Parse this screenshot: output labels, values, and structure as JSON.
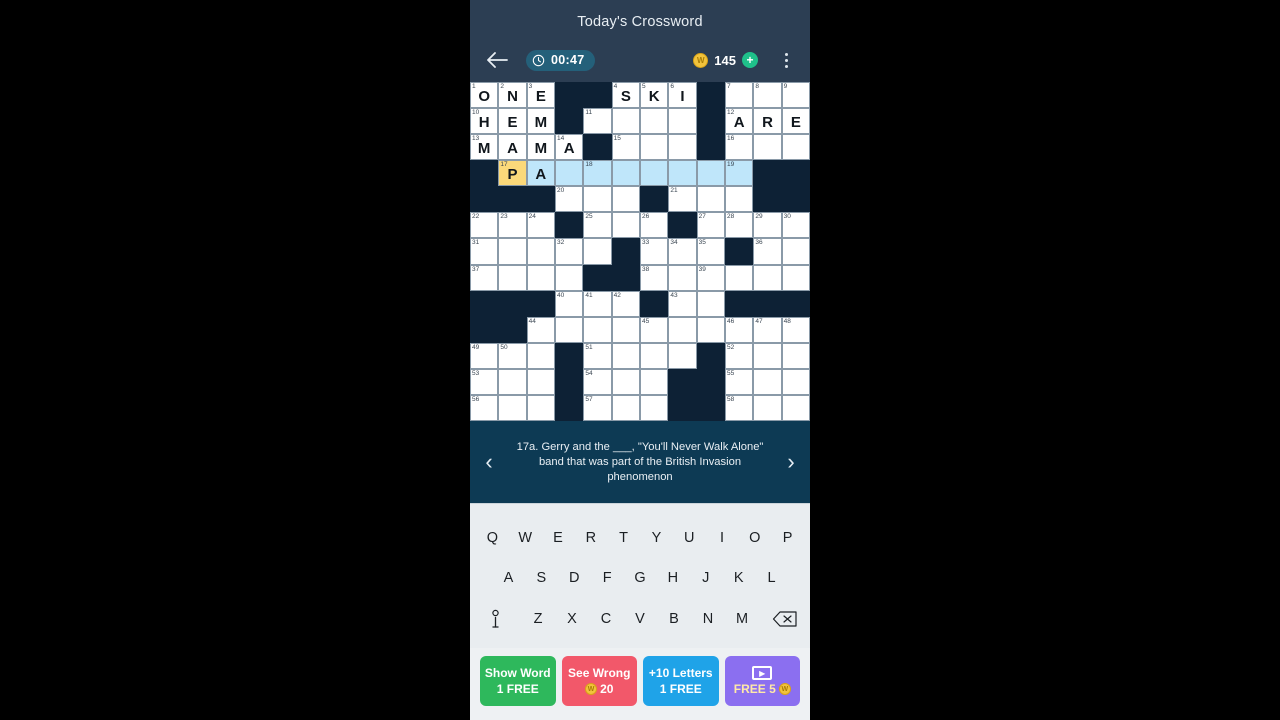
{
  "header": {
    "title": "Today's Crossword",
    "back_icon": "back-arrow-icon",
    "clock_icon": "clock-icon",
    "timer": "00:47",
    "coin_icon": "coin-icon",
    "coin_count": "145",
    "plus_label": "+",
    "menu_icon": "overflow-menu-icon"
  },
  "grid": {
    "rows": 12,
    "cols": 12,
    "colors": {
      "block": "#0d2135",
      "empty": "#ffffff",
      "highlight": "#bfe6fa",
      "cursor": "#fbd97a",
      "border": "#8a9aa8"
    },
    "cells": [
      [
        {
          "n": "1",
          "l": "O"
        },
        {
          "n": "2",
          "l": "N"
        },
        {
          "n": "3",
          "l": "E"
        },
        {
          "b": true
        },
        {
          "b": true
        },
        {
          "n": "4",
          "l": "S"
        },
        {
          "n": "5",
          "l": "K"
        },
        {
          "n": "6",
          "l": "I"
        },
        {
          "b": true
        },
        {
          "n": "7"
        },
        {
          "n": "8"
        },
        {
          "n": "9"
        }
      ],
      [
        {
          "n": "10",
          "l": "H"
        },
        {
          "l": "E"
        },
        {
          "l": "M"
        },
        {
          "b": true
        },
        {
          "n": "11"
        },
        {},
        {},
        {},
        {
          "b": true
        },
        {
          "n": "12",
          "l": "A"
        },
        {
          "l": "R"
        },
        {
          "l": "E"
        }
      ],
      [
        {
          "n": "13",
          "l": "M"
        },
        {
          "l": "A"
        },
        {
          "l": "M"
        },
        {
          "n": "14",
          "l": "A"
        },
        {
          "b": true
        },
        {
          "n": "15"
        },
        {},
        {},
        {
          "b": true
        },
        {
          "n": "16"
        },
        {},
        {}
      ],
      [
        {
          "b": true
        },
        {
          "n": "17",
          "l": "P",
          "c": true
        },
        {
          "l": "A",
          "h": true
        },
        {
          "h": true
        },
        {
          "n": "18",
          "h": true
        },
        {
          "h": true
        },
        {
          "h": true
        },
        {
          "h": true
        },
        {
          "h": true
        },
        {
          "n": "19",
          "h": true
        },
        {
          "b": true
        },
        {
          "b": true
        }
      ],
      [
        {
          "b": true
        },
        {
          "b": true
        },
        {
          "b": true
        },
        {
          "n": "20"
        },
        {},
        {},
        {
          "b": true
        },
        {
          "n": "21"
        },
        {},
        {},
        {
          "b": true
        },
        {
          "b": true
        }
      ],
      [
        {
          "n": "22"
        },
        {
          "n": "23"
        },
        {
          "n": "24"
        },
        {
          "b": true
        },
        {
          "n": "25"
        },
        {},
        {
          "n": "26"
        },
        {
          "b": true
        },
        {
          "n": "27"
        },
        {
          "n": "28"
        },
        {
          "n": "29"
        },
        {
          "n": "30"
        }
      ],
      [
        {
          "n": "31"
        },
        {},
        {},
        {
          "n": "32"
        },
        {},
        {
          "b": true
        },
        {
          "n": "33"
        },
        {
          "n": "34"
        },
        {
          "n": "35"
        },
        {
          "b": true
        },
        {
          "n": "36"
        },
        {}
      ],
      [
        {
          "n": "37"
        },
        {},
        {},
        {},
        {
          "b": true
        },
        {
          "b": true
        },
        {
          "n": "38"
        },
        {},
        {
          "n": "39"
        },
        {},
        {},
        {}
      ],
      [
        {
          "b": true
        },
        {
          "b": true
        },
        {
          "b": true
        },
        {
          "n": "40"
        },
        {
          "n": "41"
        },
        {
          "n": "42"
        },
        {
          "b": true
        },
        {
          "n": "43"
        },
        {},
        {
          "b": true
        },
        {
          "b": true
        },
        {
          "b": true
        }
      ],
      [
        {
          "b": true
        },
        {
          "b": true
        },
        {
          "n": "44"
        },
        {},
        {},
        {},
        {
          "n": "45"
        },
        {},
        {},
        {
          "n": "46"
        },
        {
          "n": "47"
        },
        {
          "n": "48"
        }
      ],
      [
        {
          "n": "49"
        },
        {
          "n": "50"
        },
        {},
        {
          "b": true
        },
        {
          "n": "51"
        },
        {},
        {},
        {},
        {
          "b": true
        },
        {
          "n": "52"
        },
        {},
        {}
      ],
      [
        {
          "n": "53"
        },
        {},
        {},
        {
          "b": true
        },
        {
          "n": "54"
        },
        {},
        {},
        {
          "b": true
        },
        {
          "b": true
        },
        {
          "n": "55"
        },
        {},
        {}
      ],
      [
        {
          "n": "56"
        },
        {},
        {},
        {
          "b": true
        },
        {
          "n": "57"
        },
        {},
        {},
        {
          "b": true
        },
        {
          "b": true
        },
        {
          "n": "58"
        },
        {},
        {}
      ]
    ]
  },
  "clue": {
    "prev_icon": "chevron-left-icon",
    "next_icon": "chevron-right-icon",
    "text": "17a. Gerry and the ___, \"You'll Never Walk Alone\" band that was part of the British Invasion phenomenon"
  },
  "keyboard": {
    "row1": [
      "Q",
      "W",
      "E",
      "R",
      "T",
      "Y",
      "U",
      "I",
      "O",
      "P"
    ],
    "row2": [
      "A",
      "S",
      "D",
      "F",
      "G",
      "H",
      "J",
      "K",
      "L"
    ],
    "row3": [
      "Z",
      "X",
      "C",
      "V",
      "B",
      "N",
      "M"
    ],
    "info_icon": "info-icon",
    "backspace_icon": "backspace-icon"
  },
  "powerups": [
    {
      "name": "show-word",
      "line1": "Show Word",
      "line2": "1 FREE",
      "color": "#2eb85c",
      "coin": false,
      "video": false
    },
    {
      "name": "see-wrong",
      "line1": "See Wrong",
      "line2": "20",
      "color": "#f2586a",
      "coin": true,
      "video": false
    },
    {
      "name": "plus-ten-letters",
      "line1": "+10 Letters",
      "line2": "1 FREE",
      "color": "#1fa3e8",
      "coin": false,
      "video": false
    },
    {
      "name": "free-coins-video",
      "line1": "",
      "line2": "FREE 5",
      "color": "#8b6ff0",
      "coin": true,
      "video": true
    }
  ]
}
